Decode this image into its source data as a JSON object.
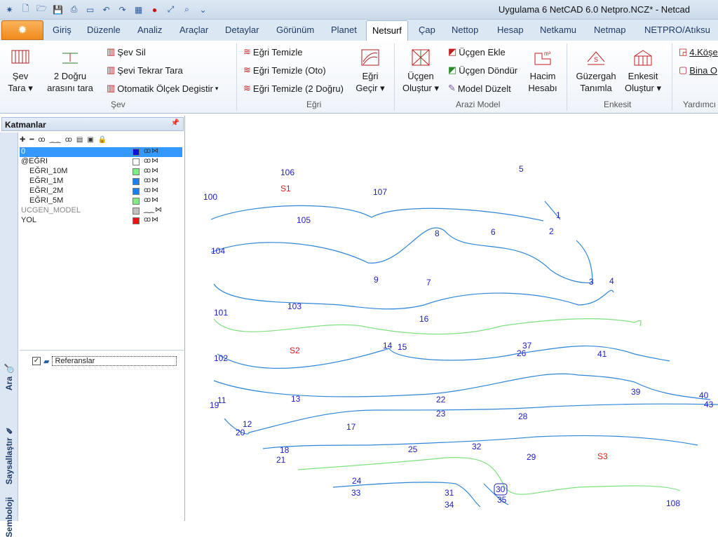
{
  "window": {
    "title": "Uygulama 6 NetCAD 6.0 Netpro.NCZ* - Netcad"
  },
  "tabs": [
    "Giriş",
    "Düzenle",
    "Analiz",
    "Araçlar",
    "Detaylar",
    "Görünüm",
    "Planet",
    "Netsurf",
    "Çap",
    "Nettop",
    "Hesap",
    "Netkamu",
    "Netmap",
    "NETPRO/Atıksu"
  ],
  "active_tab": "Netsurf",
  "ribbon": {
    "sev": {
      "label": "Şev",
      "big1_l1": "Şev",
      "big1_l2": "Tara",
      "big2_l1": "2 Doğru",
      "big2_l2": "arasını tara",
      "s1": "Şev Sil",
      "s2": "Şevi Tekrar Tara",
      "s3": "Otomatik Ölçek Degistir"
    },
    "egri": {
      "label": "Eğri",
      "s1": "Eğri Temizle",
      "s2": "Eğri Temizle (Oto)",
      "s3": "Eğri Temizle (2 Doğru)",
      "big_l1": "Eğri",
      "big_l2": "Geçir"
    },
    "arazi": {
      "label": "Arazi Model",
      "big1_l1": "Üçgen",
      "big1_l2": "Oluştur",
      "s1": "Üçgen Ekle",
      "s2": "Üçgen Döndür",
      "s3": "Model Düzelt",
      "big2_l1": "Hacim",
      "big2_l2": "Hesabı"
    },
    "enkesit": {
      "label": "Enkesit",
      "big1_l1": "Güzergah",
      "big1_l2": "Tanımla",
      "big2_l1": "Enkesit",
      "big2_l2": "Oluştur"
    },
    "yardimci": {
      "label": "Yardımcı",
      "s1": "4.Köşe",
      "s2": "Bina O"
    }
  },
  "panel": {
    "title": "Katmanlar",
    "side_tabs": [
      "Ara",
      "Saysallaştır",
      "Semboloji"
    ],
    "layers": [
      {
        "name": "0",
        "color": "#1010e0",
        "selected": true
      },
      {
        "name": "@EĞRI",
        "color": "#ffffff"
      },
      {
        "name": "EĞRI_10M",
        "color": "#80ee80"
      },
      {
        "name": "EĞRI_1M",
        "color": "#1a7ff0"
      },
      {
        "name": "EĞRI_2M",
        "color": "#1a7ff0"
      },
      {
        "name": "EĞRI_5M",
        "color": "#80ee80"
      },
      {
        "name": "UCGEN_MODEL",
        "color": "#c0c0c0"
      },
      {
        "name": "YOL",
        "color": "#ee1111"
      }
    ],
    "reference": "Referanslar"
  },
  "canvas": {
    "colors": {
      "blue_curve": "#2e86d8",
      "green_curve": "#7ee27e",
      "point_label": "#2020c0",
      "s_label": "#e01a1a"
    },
    "points": [
      "106",
      "5",
      "S1",
      "107",
      "100",
      "1",
      "105",
      "8",
      "6",
      "2",
      "104",
      "9",
      "7",
      "3",
      "4",
      "101",
      "103",
      "16",
      "S2",
      "14",
      "15",
      "37",
      "26",
      "41",
      "102",
      "39",
      "40",
      "43",
      "11",
      "19",
      "13",
      "22",
      "23",
      "28",
      "12",
      "20",
      "17",
      "18",
      "25",
      "32",
      "21",
      "29",
      "S3",
      "24",
      "33",
      "30",
      "35",
      "31",
      "34",
      "108"
    ]
  }
}
